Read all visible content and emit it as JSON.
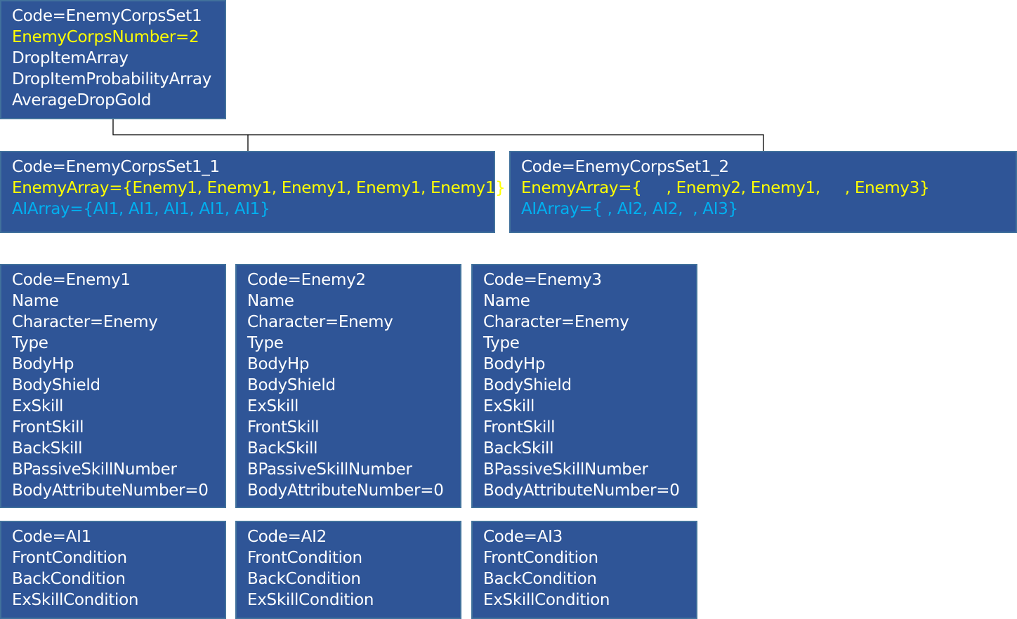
{
  "colors": {
    "box_fill": "#2F5597",
    "box_border": "#41719C",
    "text_default": "#FFFFFF",
    "text_yellow": "#FFFF00",
    "text_cyan": "#00B0F0",
    "connector": "#000000"
  },
  "corps_set": {
    "lines": [
      {
        "text": "Code=EnemyCorpsSet1",
        "color": "white"
      },
      {
        "text": "EnemyCorpsNumber=2",
        "color": "yellow"
      },
      {
        "text": "DropItemArray",
        "color": "white"
      },
      {
        "text": "DropItemProbabilityArray",
        "color": "white"
      },
      {
        "text": "AverageDropGold",
        "color": "white"
      }
    ]
  },
  "sub_sets": [
    {
      "lines": [
        {
          "text": "Code=EnemyCorpsSet1_1",
          "color": "white"
        },
        {
          "text": "EnemyArray={Enemy1, Enemy1, Enemy1, Enemy1, Enemy1}",
          "color": "yellow"
        },
        {
          "text": "AIArray={AI1, AI1, AI1, AI1, AI1}",
          "color": "cyan"
        }
      ]
    },
    {
      "lines": [
        {
          "text": "Code=EnemyCorpsSet1_2",
          "color": "white"
        },
        {
          "text": "EnemyArray={     , Enemy2, Enemy1,     , Enemy3}",
          "color": "yellow"
        },
        {
          "text": "AIArray={ , AI2, AI2,  , AI3}",
          "color": "cyan"
        }
      ]
    }
  ],
  "enemies": [
    {
      "lines": [
        "Code=Enemy1",
        "Name",
        "Character=Enemy",
        "Type",
        "BodyHp",
        "BodyShield",
        "ExSkill",
        "FrontSkill",
        "BackSkill",
        "BPassiveSkillNumber",
        "BodyAttributeNumber=0"
      ]
    },
    {
      "lines": [
        "Code=Enemy2",
        "Name",
        "Character=Enemy",
        "Type",
        "BodyHp",
        "BodyShield",
        "ExSkill",
        "FrontSkill",
        "BackSkill",
        "BPassiveSkillNumber",
        "BodyAttributeNumber=0"
      ]
    },
    {
      "lines": [
        "Code=Enemy3",
        "Name",
        "Character=Enemy",
        "Type",
        "BodyHp",
        "BodyShield",
        "ExSkill",
        "FrontSkill",
        "BackSkill",
        "BPassiveSkillNumber",
        "BodyAttributeNumber=0"
      ]
    }
  ],
  "ais": [
    {
      "lines": [
        "Code=AI1",
        "FrontCondition",
        "BackCondition",
        "ExSkillCondition"
      ]
    },
    {
      "lines": [
        "Code=AI2",
        "FrontCondition",
        "BackCondition",
        "ExSkillCondition"
      ]
    },
    {
      "lines": [
        "Code=AI3",
        "FrontCondition",
        "BackCondition",
        "ExSkillCondition"
      ]
    }
  ]
}
